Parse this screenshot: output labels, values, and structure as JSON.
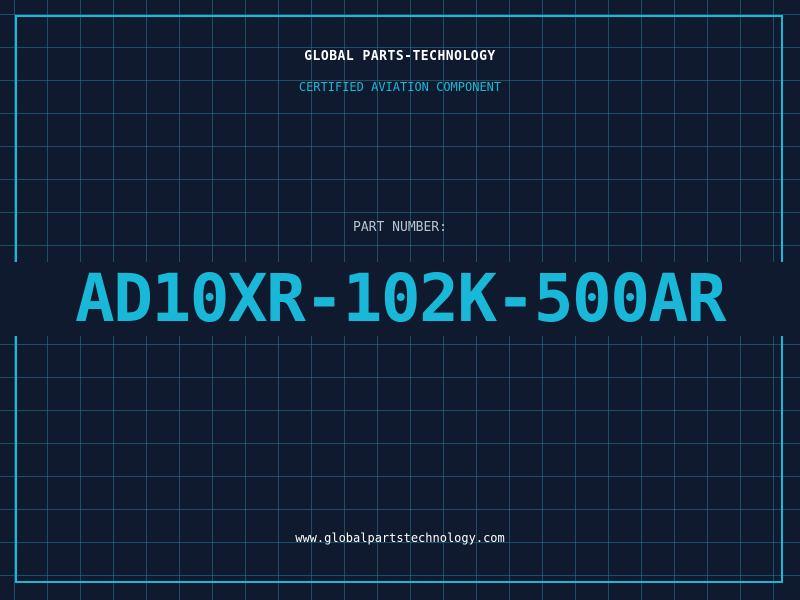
{
  "header": {
    "company": "GLOBAL PARTS-TECHNOLOGY",
    "tagline": "CERTIFIED AVIATION COMPONENT"
  },
  "part": {
    "label": "PART NUMBER:",
    "number": "AD10XR-102K-500AR"
  },
  "footer": {
    "website": "www.globalpartstechnology.com"
  },
  "colors": {
    "background": "#0f1a2e",
    "accent": "#1ab8d8",
    "text": "#ffffff",
    "muted": "#b8c4d0"
  }
}
